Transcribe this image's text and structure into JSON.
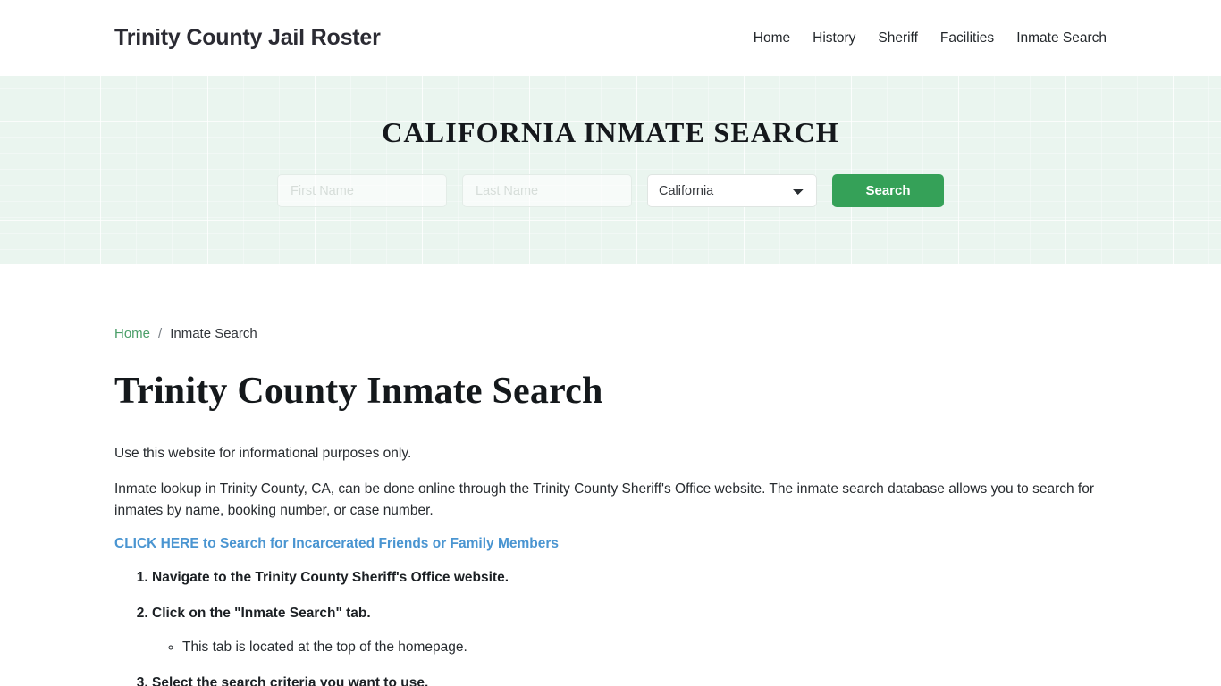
{
  "header": {
    "brand": "Trinity County Jail Roster",
    "nav": [
      {
        "label": "Home"
      },
      {
        "label": "History"
      },
      {
        "label": "Sheriff"
      },
      {
        "label": "Facilities"
      },
      {
        "label": "Inmate Search"
      }
    ]
  },
  "hero": {
    "title": "CALIFORNIA INMATE SEARCH",
    "first_name_placeholder": "First Name",
    "first_name_value": "",
    "last_name_placeholder": "Last Name",
    "last_name_value": "",
    "state_selected": "California",
    "search_button": "Search",
    "background_color": "#eaf5ef",
    "button_color": "#35a158"
  },
  "breadcrumb": {
    "home": "Home",
    "separator": "/",
    "current": "Inmate Search",
    "link_color": "#4a9e68"
  },
  "main": {
    "page_title": "Trinity County Inmate Search",
    "paragraph_1": "Use this website for informational purposes only.",
    "paragraph_2": "Inmate lookup in Trinity County, CA, can be done online through the Trinity County Sheriff's Office website. The inmate search database allows you to search for inmates by name, booking number, or case number.",
    "cta_link": "CLICK HERE to Search for Incarcerated Friends or Family Members",
    "cta_color": "#4a95d1",
    "steps": [
      {
        "text": "Navigate to the Trinity County Sheriff's Office website.",
        "substeps": []
      },
      {
        "text": "Click on the \"Inmate Search\" tab.",
        "substeps": [
          {
            "text": "This tab is located at the top of the homepage."
          }
        ]
      },
      {
        "text": "Select the search criteria you want to use.",
        "substeps": []
      }
    ]
  }
}
